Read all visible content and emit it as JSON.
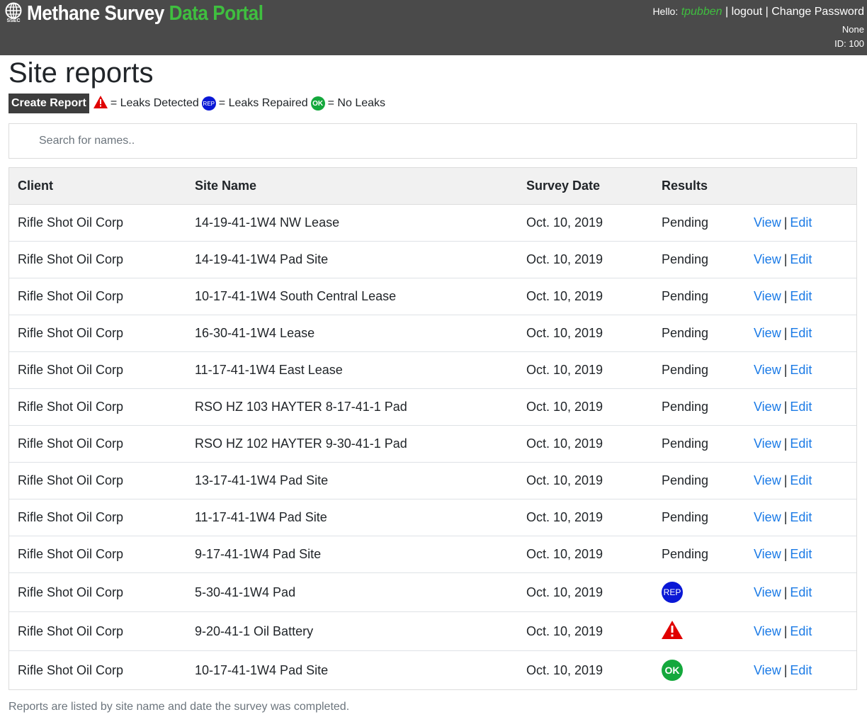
{
  "header": {
    "brand_logo_text": "SSEC",
    "brand_part1": "Methane Survey",
    "brand_part2": "Data Portal",
    "hello_label": "Hello:",
    "username": "tpubben",
    "logout_label": "logout",
    "change_password_label": "Change Password",
    "org_line": "None",
    "id_line": "ID: 100",
    "separator": "|"
  },
  "page": {
    "title": "Site reports",
    "create_report_label": "Create Report",
    "legend": {
      "leaks_detected": "= Leaks Detected",
      "leaks_repaired": "= Leaks Repaired",
      "no_leaks": "= No Leaks"
    },
    "search_placeholder": "Search for names..",
    "footer_note": "Reports are listed by site name and date the survey was completed."
  },
  "icons": {
    "rep_text": "REP",
    "ok_text": "OK",
    "leak_color": "#e00000",
    "rep_color": "#0a18d6",
    "ok_color": "#14a83c"
  },
  "table": {
    "headers": [
      "Client",
      "Site Name",
      "Survey Date",
      "Results"
    ],
    "view_label": "View",
    "edit_label": "Edit",
    "rows": [
      {
        "client": "Rifle Shot Oil Corp",
        "site": "14-19-41-1W4 NW Lease",
        "date": "Oct. 10, 2019",
        "result": "Pending"
      },
      {
        "client": "Rifle Shot Oil Corp",
        "site": "14-19-41-1W4 Pad Site",
        "date": "Oct. 10, 2019",
        "result": "Pending"
      },
      {
        "client": "Rifle Shot Oil Corp",
        "site": "10-17-41-1W4 South Central Lease",
        "date": "Oct. 10, 2019",
        "result": "Pending"
      },
      {
        "client": "Rifle Shot Oil Corp",
        "site": "16-30-41-1W4 Lease",
        "date": "Oct. 10, 2019",
        "result": "Pending"
      },
      {
        "client": "Rifle Shot Oil Corp",
        "site": "11-17-41-1W4 East Lease",
        "date": "Oct. 10, 2019",
        "result": "Pending"
      },
      {
        "client": "Rifle Shot Oil Corp",
        "site": "RSO HZ 103 HAYTER 8-17-41-1 Pad",
        "date": "Oct. 10, 2019",
        "result": "Pending"
      },
      {
        "client": "Rifle Shot Oil Corp",
        "site": "RSO HZ 102 HAYTER 9-30-41-1 Pad",
        "date": "Oct. 10, 2019",
        "result": "Pending"
      },
      {
        "client": "Rifle Shot Oil Corp",
        "site": "13-17-41-1W4 Pad Site",
        "date": "Oct. 10, 2019",
        "result": "Pending"
      },
      {
        "client": "Rifle Shot Oil Corp",
        "site": "11-17-41-1W4 Pad Site",
        "date": "Oct. 10, 2019",
        "result": "Pending"
      },
      {
        "client": "Rifle Shot Oil Corp",
        "site": "9-17-41-1W4 Pad Site",
        "date": "Oct. 10, 2019",
        "result": "Pending"
      },
      {
        "client": "Rifle Shot Oil Corp",
        "site": "5-30-41-1W4 Pad",
        "date": "Oct. 10, 2019",
        "result": "leaks-repaired-icon"
      },
      {
        "client": "Rifle Shot Oil Corp",
        "site": "9-20-41-1 Oil Battery",
        "date": "Oct. 10, 2019",
        "result": "leaks-detected-icon"
      },
      {
        "client": "Rifle Shot Oil Corp",
        "site": "10-17-41-1W4 Pad Site",
        "date": "Oct. 10, 2019",
        "result": "no-leaks-icon"
      }
    ]
  }
}
